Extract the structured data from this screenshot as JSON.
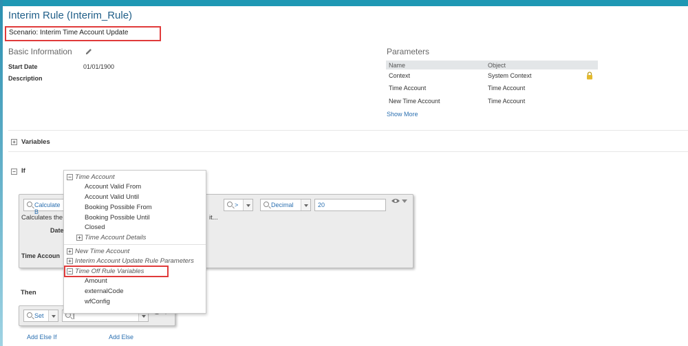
{
  "header": {
    "title": "Interim Rule (Interim_Rule)",
    "scenario": "Scenario: Interim Time Account Update"
  },
  "basic_info": {
    "heading": "Basic Information",
    "start_date_label": "Start Date",
    "start_date_value": "01/01/1900",
    "description_label": "Description"
  },
  "parameters": {
    "heading": "Parameters",
    "col_name": "Name",
    "col_object": "Object",
    "rows": [
      {
        "name": "Context",
        "object": "System Context"
      },
      {
        "name": "Time Account",
        "object": "Time Account"
      },
      {
        "name": "New Time Account",
        "object": "Time Account"
      }
    ],
    "show_more": "Show More"
  },
  "sections": {
    "variables": "Variables",
    "if": "If",
    "then": "Then"
  },
  "if_block": {
    "left_field": "Calculate B",
    "description": "Calculates the",
    "description_tail": "it...",
    "date_label": "Date",
    "time_account_label": "Time Accoun",
    "operator": ">",
    "type": "Decimal",
    "value": "20"
  },
  "dropdown": {
    "groups": [
      {
        "label": "Time Account",
        "expanded": true
      },
      {
        "label": "New Time Account",
        "expanded": false
      },
      {
        "label": "Interim Account Update Rule Parameters",
        "expanded": false
      },
      {
        "label": "Time Off Rule Variables",
        "expanded": true
      }
    ],
    "time_account_items": [
      "Account Valid From",
      "Account Valid Until",
      "Booking Possible From",
      "Booking Possible Until",
      "Closed"
    ],
    "time_account_subgroup": "Time Account Details",
    "time_off_items": [
      "Amount",
      "externalCode",
      "wfConfig"
    ]
  },
  "then_block": {
    "action": "Set",
    "input_value": "|"
  },
  "footer": {
    "add_else_if": "Add Else If",
    "add_else": "Add Else"
  },
  "colors": {
    "accent": "#1f98b4",
    "link": "#2a6fb0",
    "highlight": "#e03a3a"
  }
}
